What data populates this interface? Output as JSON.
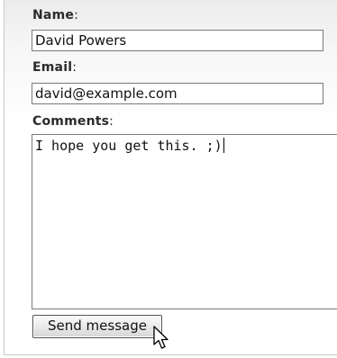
{
  "form": {
    "name": {
      "label": "Name",
      "colon": ":",
      "value": "David Powers"
    },
    "email": {
      "label": "Email",
      "colon": ":",
      "value": "david@example.com"
    },
    "comments": {
      "label": "Comments",
      "colon": ":",
      "value": "I hope you get this. ;)"
    },
    "submit_label": "Send message"
  },
  "icons": {
    "pointer": "mouse-pointer-icon"
  }
}
